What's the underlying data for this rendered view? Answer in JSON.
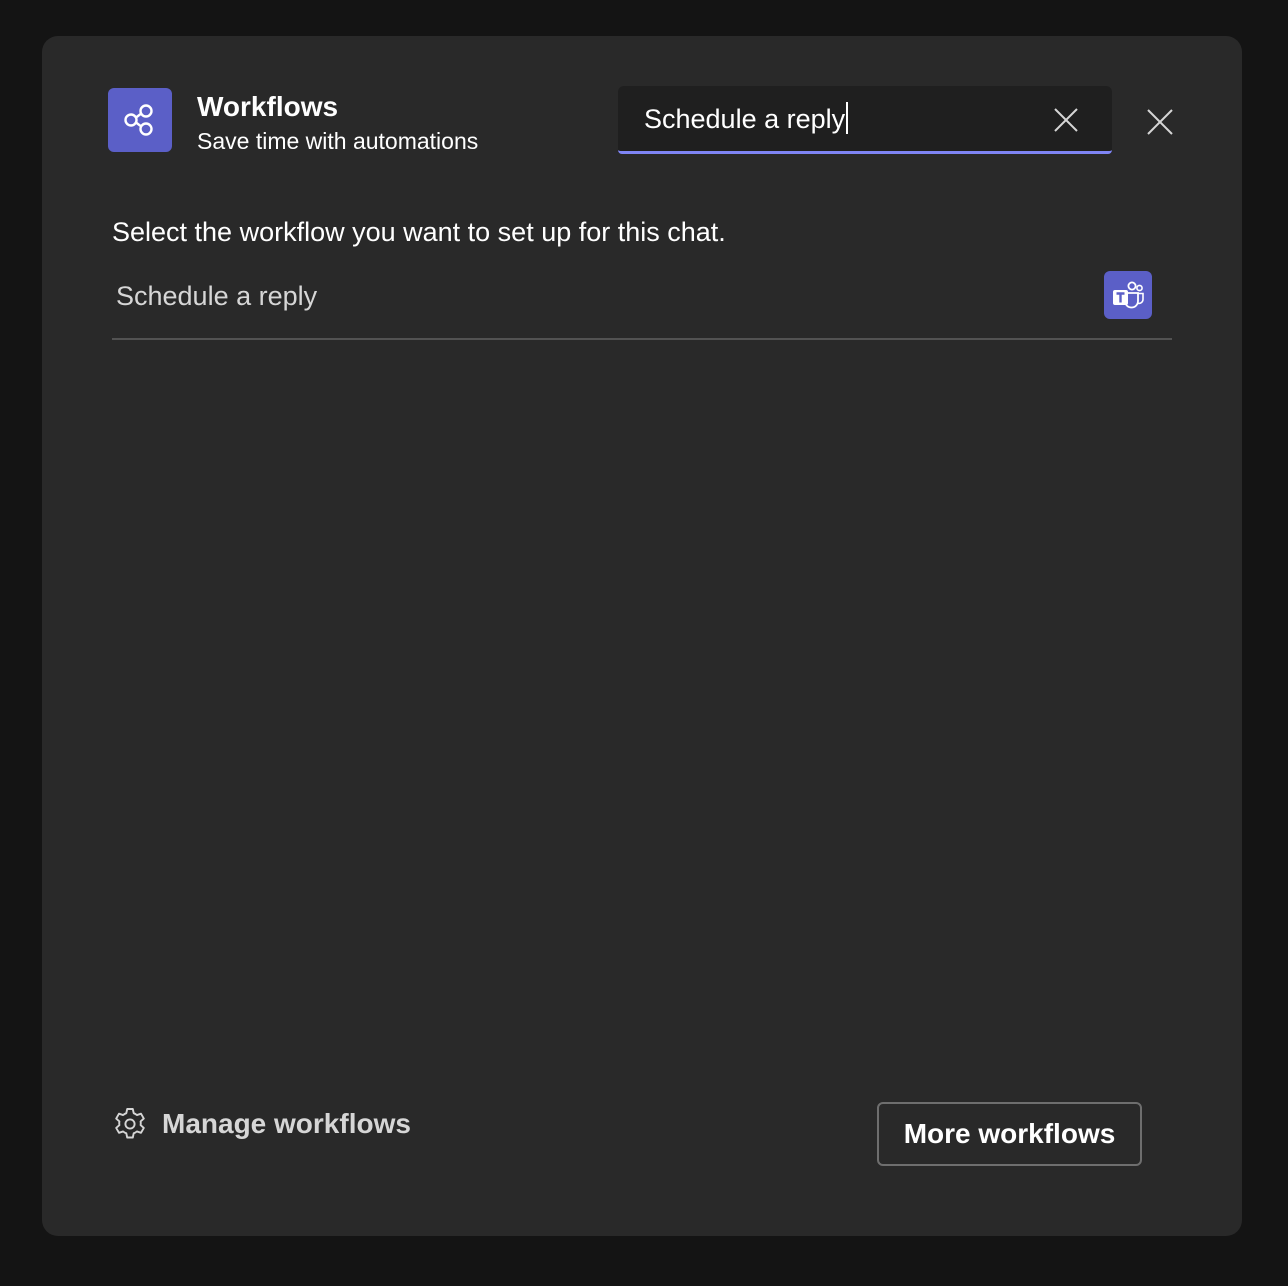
{
  "header": {
    "app_icon": "workflows-share-icon",
    "title": "Workflows",
    "subtitle": "Save time with automations"
  },
  "search": {
    "value": "Schedule a reply",
    "clear_icon": "dismiss-icon"
  },
  "close_icon": "dismiss-icon",
  "instruction": "Select the workflow you want to set up for this chat.",
  "workflows": [
    {
      "label": "Schedule a reply",
      "icon": "microsoft-teams-icon"
    }
  ],
  "footer": {
    "manage_label": "Manage workflows",
    "manage_icon": "gear-icon",
    "more_label": "More workflows"
  },
  "colors": {
    "accent": "#5b5fc7",
    "search_underline": "#7f85f5",
    "dialog_bg": "#292929",
    "page_bg": "#141414"
  }
}
